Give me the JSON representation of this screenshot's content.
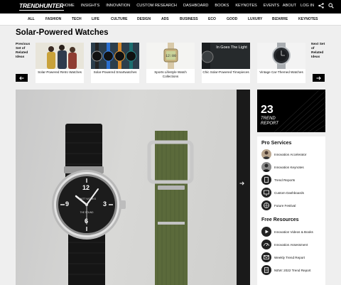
{
  "brand": {
    "logo": "TRENDHUNTER"
  },
  "nav": {
    "items": [
      "HOME",
      "INSIGHTS",
      "INNOVATION",
      "CUSTOM RESEARCH",
      "DASHBOARD",
      "BOOKS",
      "KEYNOTES",
      "EVENTS"
    ],
    "about": "ABOUT",
    "login": "LOG IN"
  },
  "categories": [
    "ALL",
    "FASHION",
    "TECH",
    "LIFE",
    "CULTURE",
    "DESIGN",
    "ADS",
    "BUSINESS",
    "ECO",
    "GOOD",
    "LUXURY",
    "BIZARRE",
    "KEYNOTES"
  ],
  "page": {
    "title": "Solar-Powered Watches"
  },
  "carousel": {
    "prev_label": "Previous Set of Related Ideas",
    "next_label": "Next Set of Related Ideas",
    "cards": [
      {
        "caption": "Solar-Powered Retro Watches"
      },
      {
        "caption": "Solar-Powered Smartwatches"
      },
      {
        "caption": "Sports Lifestyle Watch Collections"
      },
      {
        "caption": "Chic Solar-Powered Timepieces",
        "overlay": "In Goes The Light"
      },
      {
        "caption": "Vintage Car-Themed Watches"
      }
    ]
  },
  "main_image": {
    "dial_brand": "MATT WORKS",
    "dial_sub": "THE SOUND",
    "numbers": [
      "12",
      "3",
      "6",
      "9"
    ]
  },
  "trend_report": {
    "year": "23",
    "title": "TREND REPORT"
  },
  "pro_services": {
    "title": "Pro Services",
    "items": [
      "Innovation Accelerator",
      "Innovation Keynotes",
      "Trend Reports",
      "Custom Dashboards",
      "Future Festival"
    ]
  },
  "free_resources": {
    "title": "Free Resources",
    "items": [
      "Innovation Videos & Books",
      "Innovation Assessment",
      "Weekly Trend Report",
      "NEW: 2022 Trend Report"
    ]
  }
}
